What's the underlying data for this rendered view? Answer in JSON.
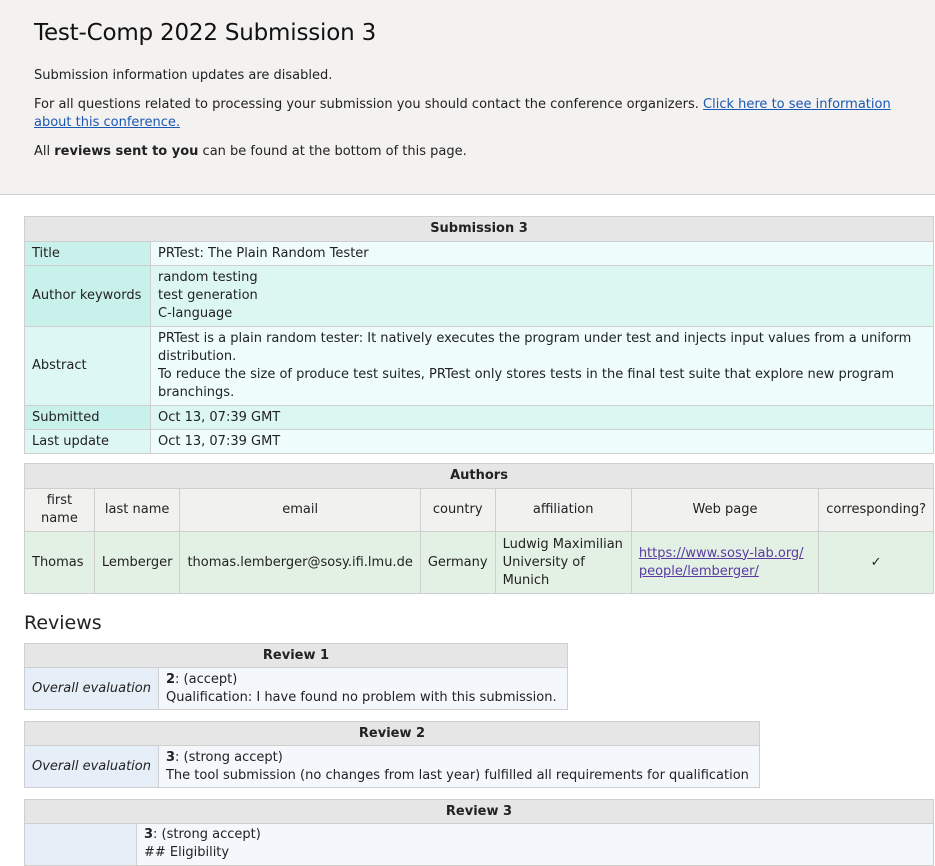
{
  "header": {
    "title": "Test-Comp 2022 Submission 3",
    "updates_disabled": "Submission information updates are disabled.",
    "contact_text": "For all questions related to processing your submission you should contact the conference organizers.",
    "contact_link": "Click here to see information about this conference.",
    "reviews_prefix": "All",
    "reviews_bold": "reviews sent to you",
    "reviews_suffix": "can be found at the bottom of this page."
  },
  "submission": {
    "heading": "Submission 3",
    "rows": {
      "title_label": "Title",
      "title_value": "PRTest: The Plain Random Tester",
      "keywords_label": "Author keywords",
      "keywords": [
        "random testing",
        "test generation",
        "C-language"
      ],
      "abstract_label": "Abstract",
      "abstract_p1": "PRTest is a plain random tester: It natively executes the program under test and injects input values from a uniform distribution.",
      "abstract_p2": "To reduce the size of produce test suites, PRTest only stores tests in the final test suite that explore new program branchings.",
      "submitted_label": "Submitted",
      "submitted_value": "Oct 13, 07:39 GMT",
      "updated_label": "Last update",
      "updated_value": "Oct 13, 07:39 GMT"
    }
  },
  "authors": {
    "heading": "Authors",
    "columns": [
      "first name",
      "last name",
      "email",
      "country",
      "affiliation",
      "Web page",
      "corresponding?"
    ],
    "rows": [
      {
        "first": "Thomas",
        "last": "Lemberger",
        "email": "thomas.lemberger@sosy.ifi.lmu.de",
        "country": "Germany",
        "affiliation": "Ludwig Maximilian University of Munich",
        "web": "https://www.sosy-lab.org/people/lemberger/",
        "corresponding": "✓"
      }
    ]
  },
  "reviews": {
    "heading": "Reviews",
    "items": [
      {
        "title": "Review 1",
        "label": "Overall evaluation",
        "score": "2",
        "verdict": ": (accept)",
        "comment": "Qualification: I have found no problem with this submission."
      },
      {
        "title": "Review 2",
        "label": "Overall evaluation",
        "score": "3",
        "verdict": ": (strong accept)",
        "comment": "The tool submission (no changes from last year) fulfilled all requirements for qualification"
      },
      {
        "title": "Review 3",
        "label": "",
        "score": "3",
        "verdict": ": (strong accept)",
        "comment": "## Eligibility"
      }
    ]
  }
}
